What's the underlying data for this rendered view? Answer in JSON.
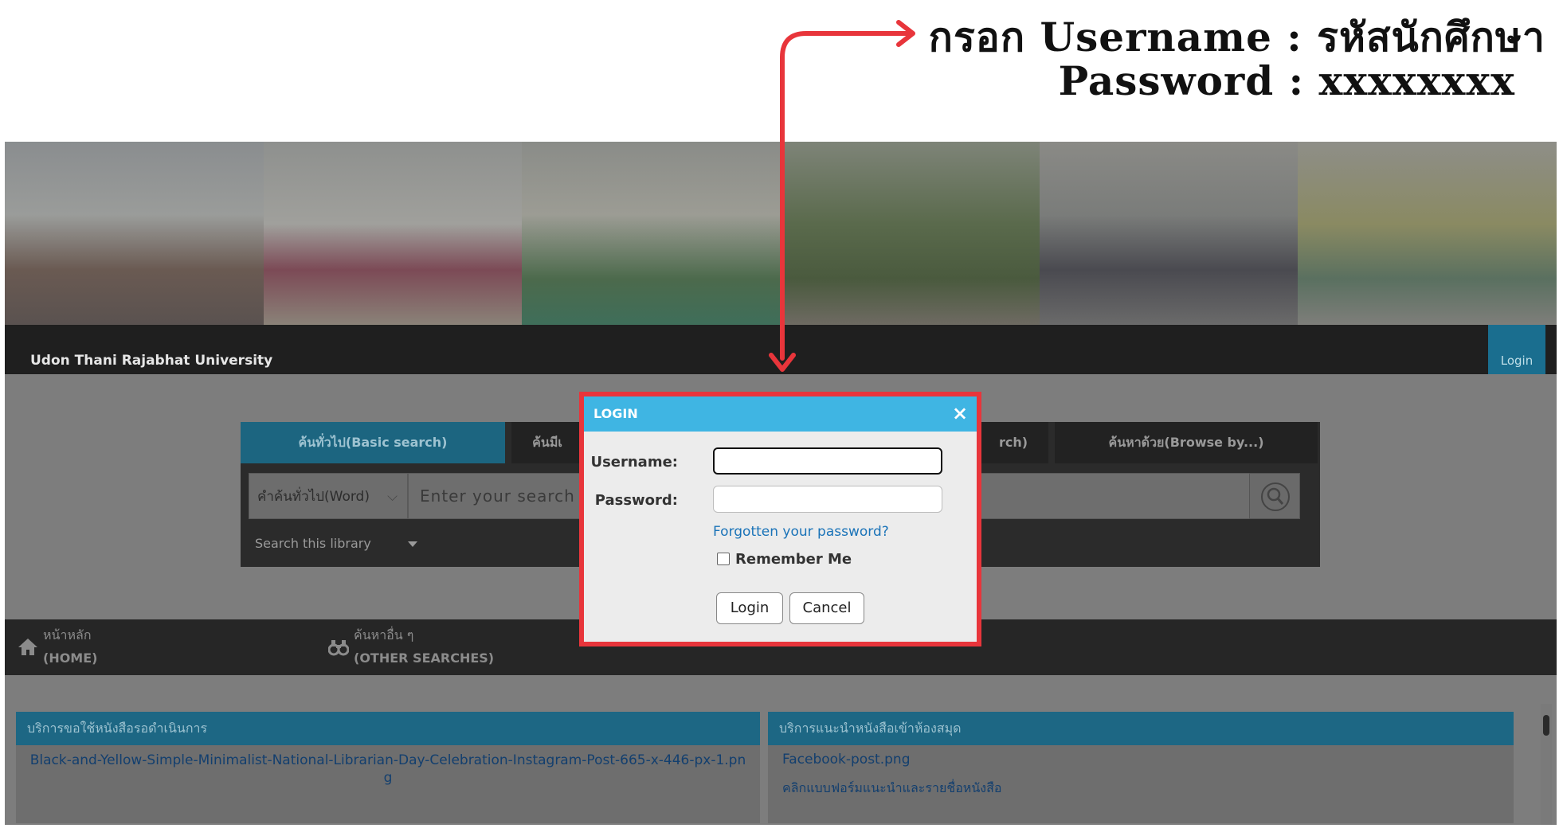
{
  "annotation": {
    "line1": "กรอก Username : รหัสนักศึกษา",
    "line2": "Password : xxxxxxxx",
    "arrow_color": "#e8353b"
  },
  "header": {
    "university": "Udon Thani Rajabhat University",
    "login_link": "Login"
  },
  "search": {
    "tabs": [
      {
        "label": "ค้นทั่วไป(Basic search)"
      },
      {
        "label": "ค้นมีเ"
      },
      {
        "label": "rch)"
      },
      {
        "label": "ค้นหาด้วย(Browse by...)"
      }
    ],
    "field_type": "คำค้นทั่วไป(Word)",
    "placeholder": "Enter your search h",
    "scope": "Search this library"
  },
  "nav": {
    "home_th": "หน้าหลัก",
    "home_en": "(HOME)",
    "other_th": "ค้นหาอื่น ๆ",
    "other_en": "(OTHER SEARCHES)"
  },
  "cards": {
    "left_title": "บริการขอใช้หนังสือรอดำเนินการ",
    "left_link": "Black-and-Yellow-Simple-Minimalist-National-Librarian-Day-Celebration-Instagram-Post-665-x-446-px-1.png",
    "right_title": "บริการแนะนำหนังสือเข้าห้องสมุด",
    "right_img": "Facebook-post.png",
    "right_link": "คลิกแบบฟอร์มแนะนำและรายชื่อหนังสือ"
  },
  "modal": {
    "title": "LOGIN",
    "close": "×",
    "username_label": "Username:",
    "password_label": "Password:",
    "forgot": "Forgotten your password?",
    "remember": "Remember Me",
    "login_btn": "Login",
    "cancel_btn": "Cancel",
    "header_color": "#3fb5e3",
    "border_color": "#e8353b"
  }
}
